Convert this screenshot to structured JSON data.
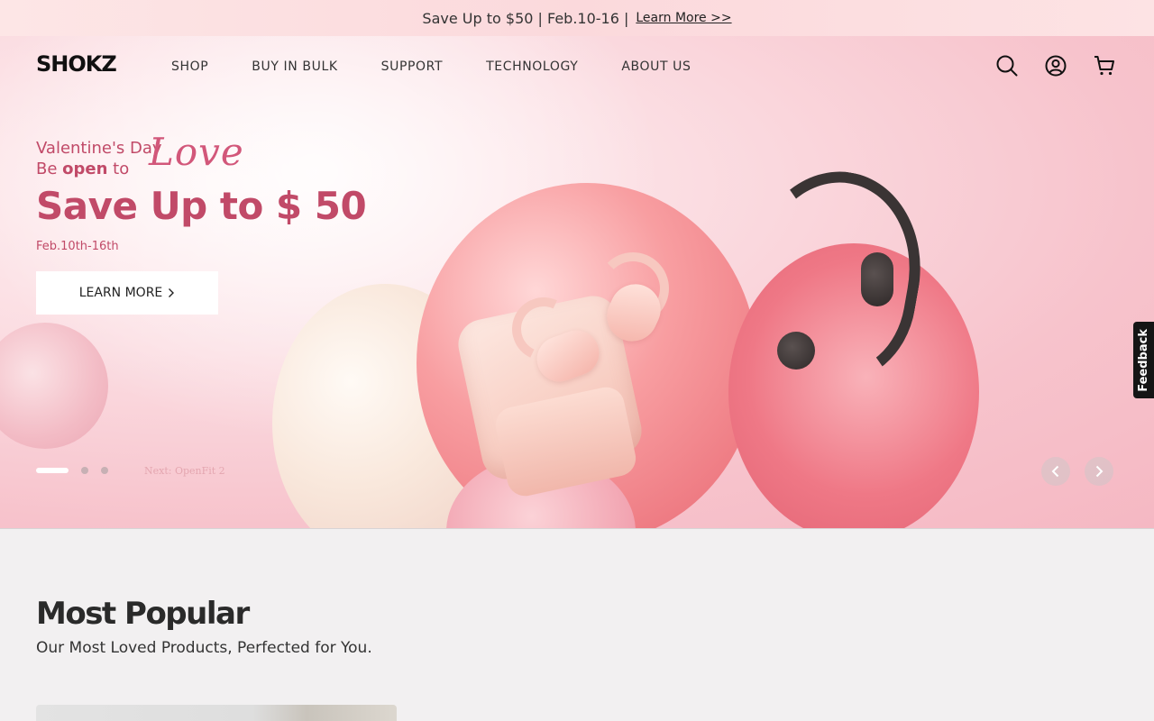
{
  "announcement": {
    "text": "Save Up to $50 | Feb.10-16 |",
    "link": "Learn More >>"
  },
  "nav": {
    "logo": "SHOKZ",
    "menu": [
      "SHOP",
      "BUY IN BULK",
      "SUPPORT",
      "TECHNOLOGY",
      "ABOUT US"
    ],
    "icons": [
      "search-icon",
      "account-icon",
      "cart-icon"
    ]
  },
  "hero": {
    "line1": "Valentine's Day",
    "line2_pre": "Be ",
    "line2_bold": "open",
    "line2_post": " to",
    "script": "Love",
    "title": "Save Up to $ 50",
    "date": "Feb.10th-16th",
    "button": "LEARN MORE",
    "next_label": "Next: OpenFit 2",
    "slide_count": 3,
    "active_slide": 1
  },
  "feedback": "Feedback",
  "popular": {
    "title": "Most Popular",
    "subtitle": "Our Most Loved Products, Perfected for You."
  },
  "colors": {
    "accent": "#c14a68",
    "announce_bg": "#fbd9dc",
    "page_bg": "#f2f0f1"
  }
}
